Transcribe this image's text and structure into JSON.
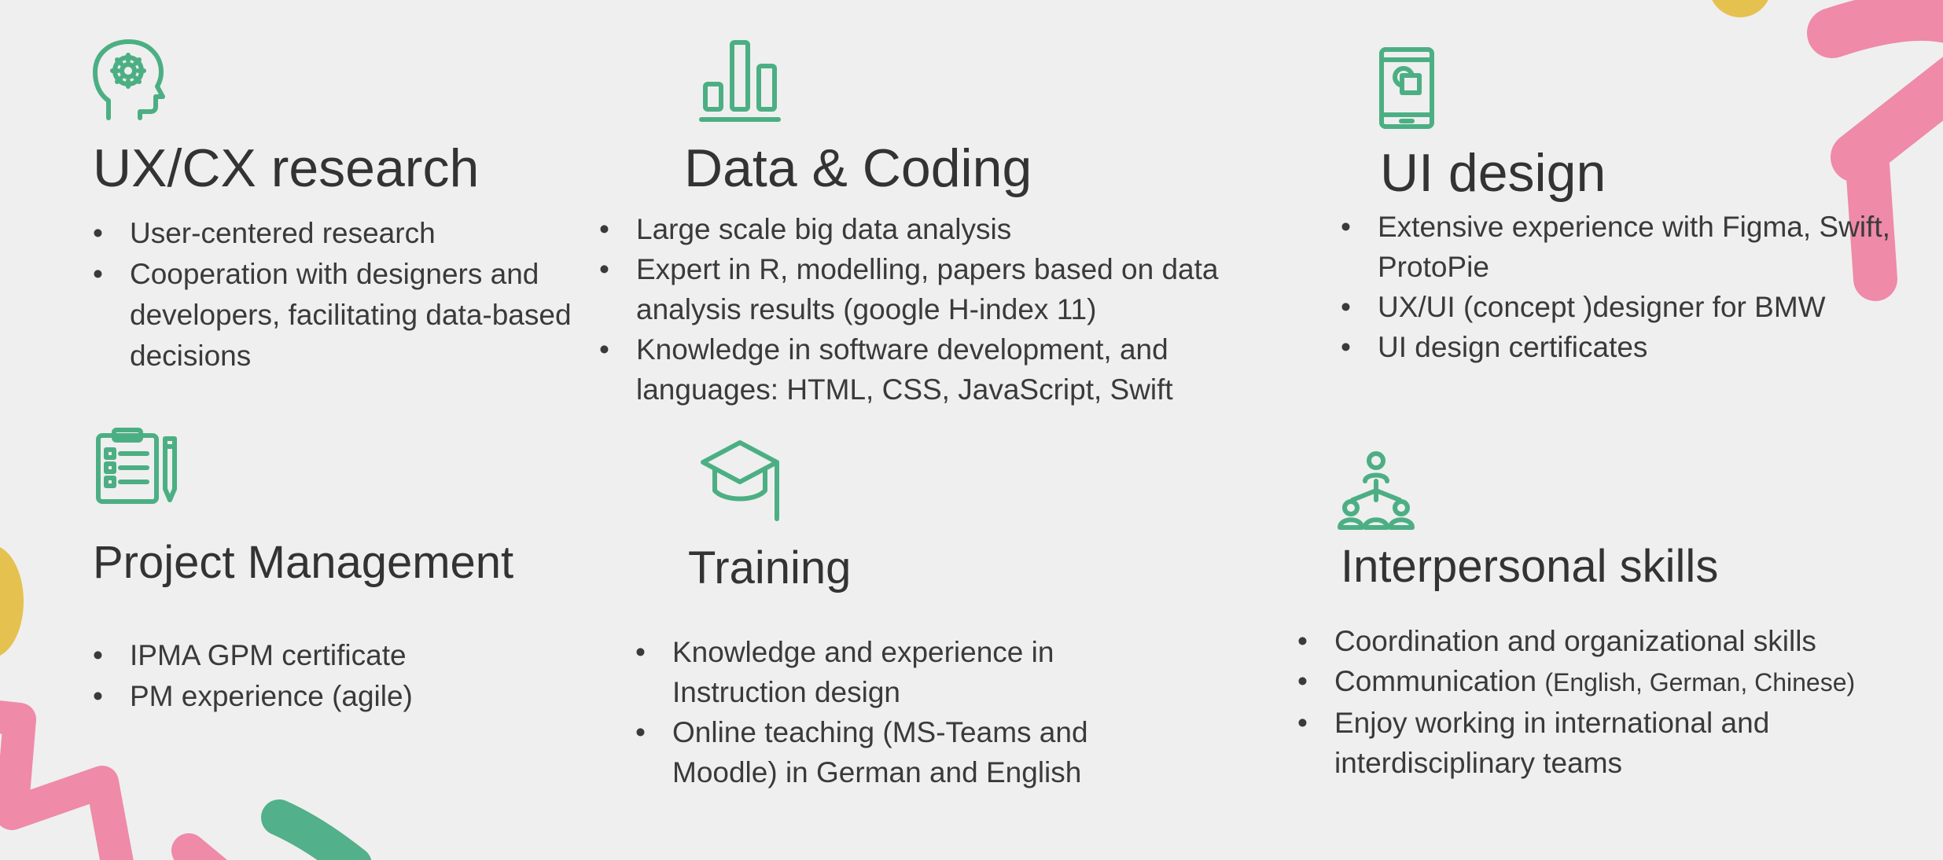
{
  "colors": {
    "background": "#efefef",
    "accent_green": "#4caf84",
    "pink": "#ef8aa8",
    "yellow": "#e5c14f",
    "text": "#333333"
  },
  "sections": [
    {
      "title": "UX/CX research",
      "icon": "head-gear-icon",
      "items": [
        {
          "text": "User-centered research"
        },
        {
          "text": "Cooperation with designers and developers, facilitating data-based decisions"
        }
      ]
    },
    {
      "title": "Data & Coding",
      "icon": "bar-chart-icon",
      "items": [
        {
          "text": "Large scale big data analysis"
        },
        {
          "text": "Expert in R, modelling, papers based on data analysis results (google H-index 11)"
        },
        {
          "text": "Knowledge in software development, and languages: HTML, CSS, JavaScript, Swift"
        }
      ]
    },
    {
      "title": "UI design",
      "icon": "mobile-phone-icon",
      "items": [
        {
          "text": "Extensive experience with Figma, Swift, ProtoPie"
        },
        {
          "text": "UX/UI (concept )designer for BMW"
        },
        {
          "text": "UI design certificates"
        }
      ]
    },
    {
      "title": "Project Management",
      "icon": "clipboard-checklist-icon",
      "items": [
        {
          "text": "IPMA GPM certificate"
        },
        {
          "text": "PM experience (agile)"
        }
      ]
    },
    {
      "title": "Training",
      "icon": "graduation-cap-icon",
      "items": [
        {
          "text": "Knowledge and experience in Instruction design"
        },
        {
          "text": "Online teaching (MS-Teams and Moodle) in German and English"
        }
      ]
    },
    {
      "title": "Interpersonal skills",
      "icon": "team-network-icon",
      "items": [
        {
          "text": "Coordination and organizational skills"
        },
        {
          "text": "Communication ",
          "note": "(English, German, Chinese)"
        },
        {
          "text": "Enjoy working in international and interdisciplinary teams"
        }
      ]
    }
  ]
}
